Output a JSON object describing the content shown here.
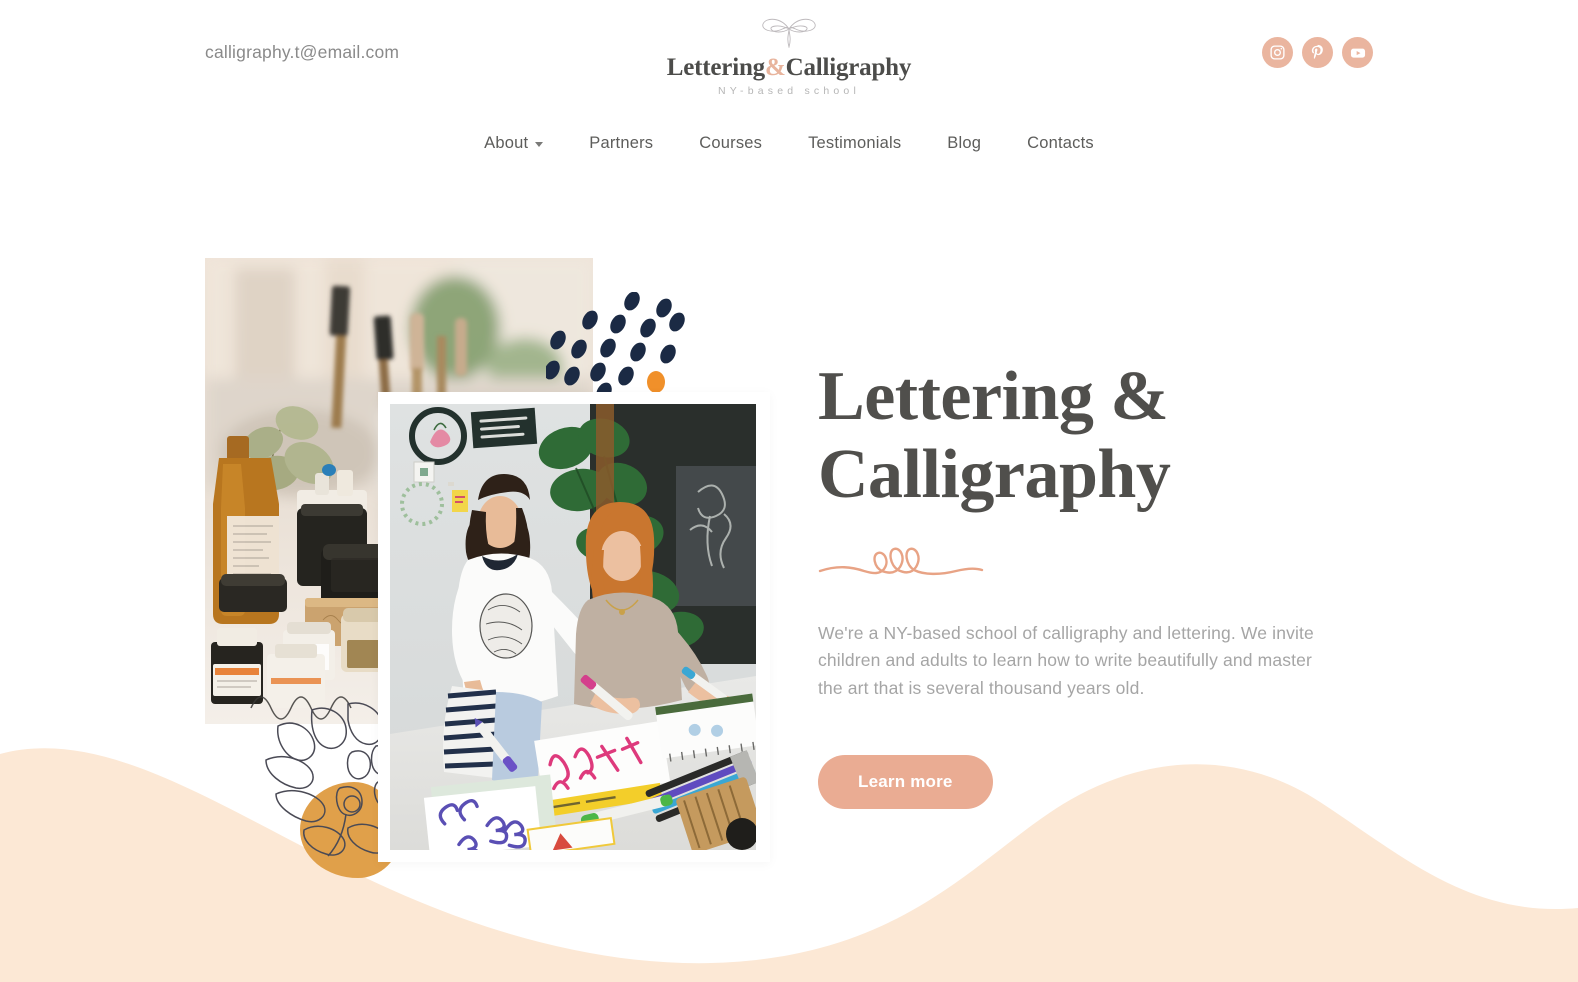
{
  "header": {
    "email": "calligraphy.t@email.com",
    "logo": {
      "title_part1": "Lettering",
      "ampersand": "&",
      "title_part2": "Calligraphy",
      "subtitle": "NY-based school",
      "ornament_icon": "calligraphic-flourish-ornament-icon"
    },
    "socials": [
      {
        "name": "instagram",
        "icon": "instagram-icon",
        "label": "Instagram"
      },
      {
        "name": "pinterest",
        "icon": "pinterest-icon",
        "label": "Pinterest"
      },
      {
        "name": "youtube",
        "icon": "youtube-icon",
        "label": "YouTube"
      }
    ]
  },
  "nav": {
    "items": [
      {
        "label": "About",
        "has_dropdown": true
      },
      {
        "label": "Partners",
        "has_dropdown": false
      },
      {
        "label": "Courses",
        "has_dropdown": false
      },
      {
        "label": "Testimonials",
        "has_dropdown": false
      },
      {
        "label": "Blog",
        "has_dropdown": false
      },
      {
        "label": "Contacts",
        "has_dropdown": false
      }
    ]
  },
  "hero": {
    "title_line1": "Lettering &",
    "title_line2": "Calligraphy",
    "flourish_icon": "calligraphy-swash-divider-icon",
    "description": "We're a NY-based school of calligraphy and lettering. We invite children and adults to learn how to write beautifully and master the art that is several thousand years old.",
    "cta_label": "Learn more",
    "images": [
      {
        "name": "studio-supplies-photo",
        "alt": "Calligraphy studio table with ink jars, brushes and amber bottle"
      },
      {
        "name": "students-workshop-photo",
        "alt": "Two women practicing calligraphy lettering at a workshop table"
      }
    ],
    "decorations": [
      {
        "name": "navy-petal-dots",
        "count": 18,
        "color": "#1b2a44"
      },
      {
        "name": "orange-accent-dot",
        "color": "#f0902a"
      },
      {
        "name": "monstera-leaf-outline",
        "color": "#4a4a55"
      },
      {
        "name": "amber-blob",
        "color": "#e0a04a"
      },
      {
        "name": "bottom-wave",
        "color": "#fce8d5"
      }
    ]
  },
  "colors": {
    "accent_salmon": "#eaac93",
    "social_bg": "#eab59f",
    "heading_gray": "#504f4c",
    "body_gray": "#a5a5a5",
    "wave_cream": "#fce8d5",
    "amber": "#e0a04a",
    "navy": "#1b2a44",
    "orange": "#f0902a",
    "page_bg": "#ffffff"
  }
}
